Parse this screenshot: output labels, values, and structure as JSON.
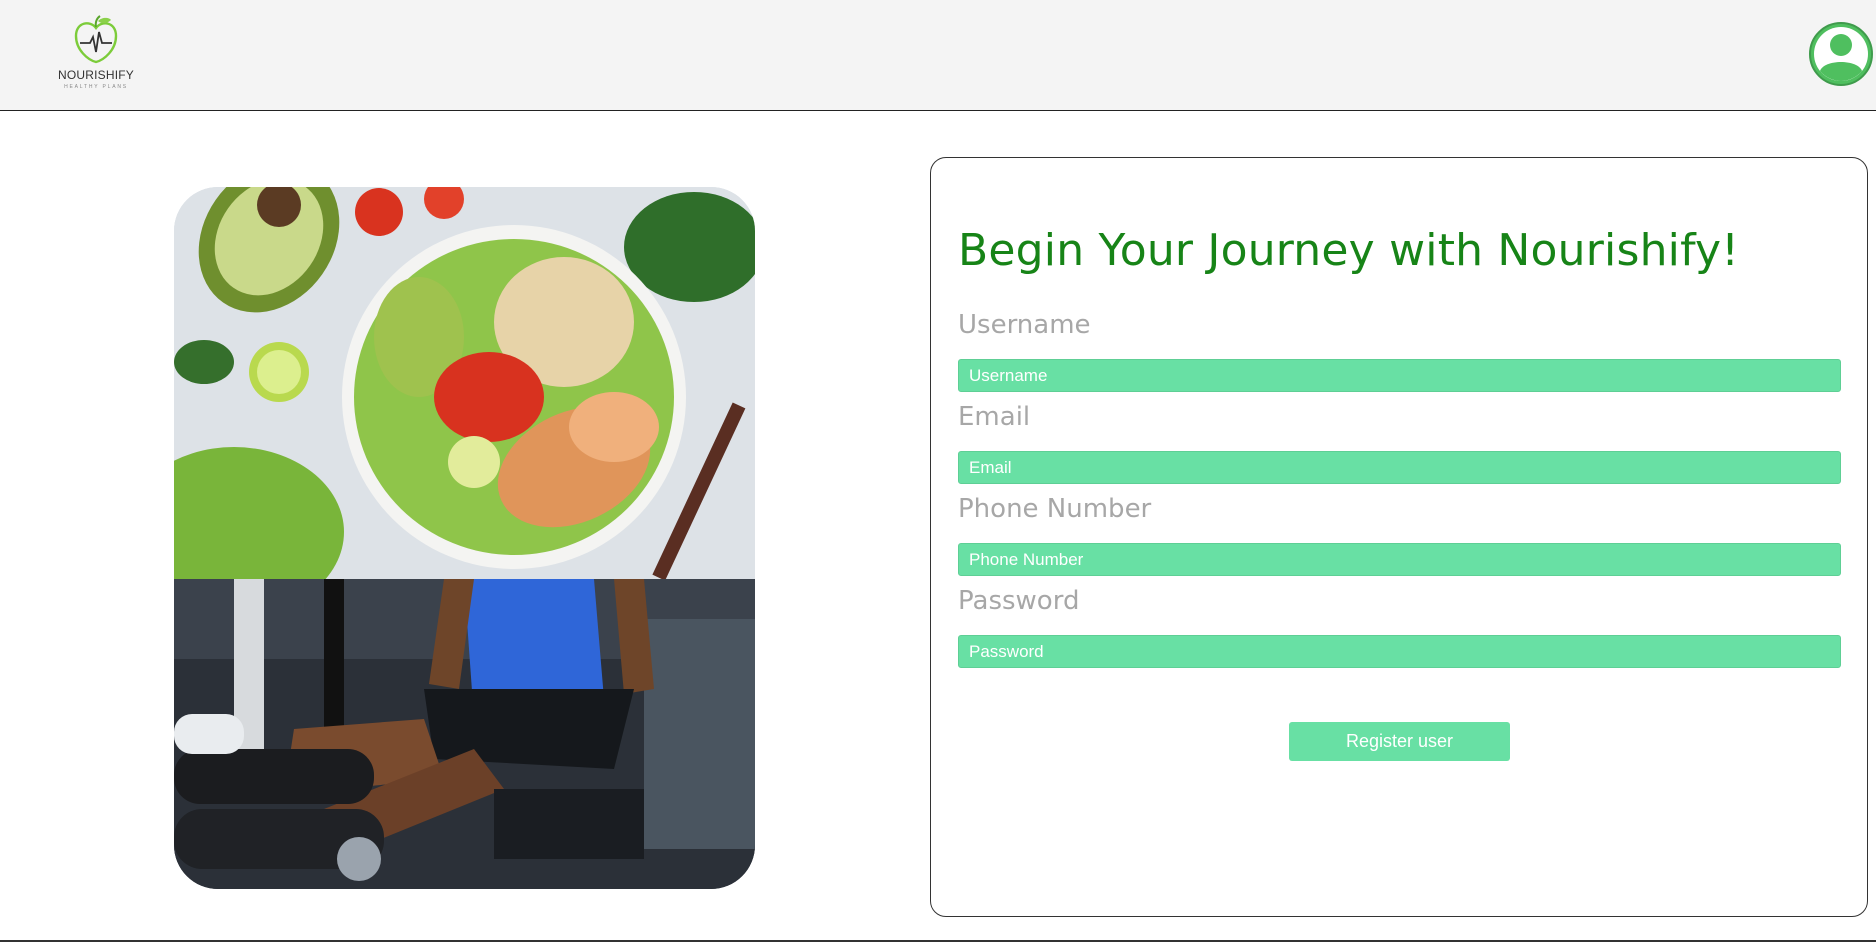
{
  "header": {
    "logo_name": "NOURISHIFY",
    "logo_tagline": "HEALTHY PLANS",
    "account_icon": "user-circle-icon"
  },
  "hero_image": {
    "top": "healthy-meal-bowl-image",
    "bottom": "gym-leg-extension-image"
  },
  "form": {
    "title": "Begin Your Journey with Nourishify!",
    "fields": [
      {
        "label": "Username",
        "placeholder": "Username"
      },
      {
        "label": "Email",
        "placeholder": "Email"
      },
      {
        "label": "Phone Number",
        "placeholder": "Phone Number"
      },
      {
        "label": "Password",
        "placeholder": "Password"
      }
    ],
    "submit_label": "Register user"
  },
  "colors": {
    "accent": "#68e0a4",
    "heading": "#178417",
    "label": "#a7a7a7",
    "topbar": "#f4f4f4"
  }
}
